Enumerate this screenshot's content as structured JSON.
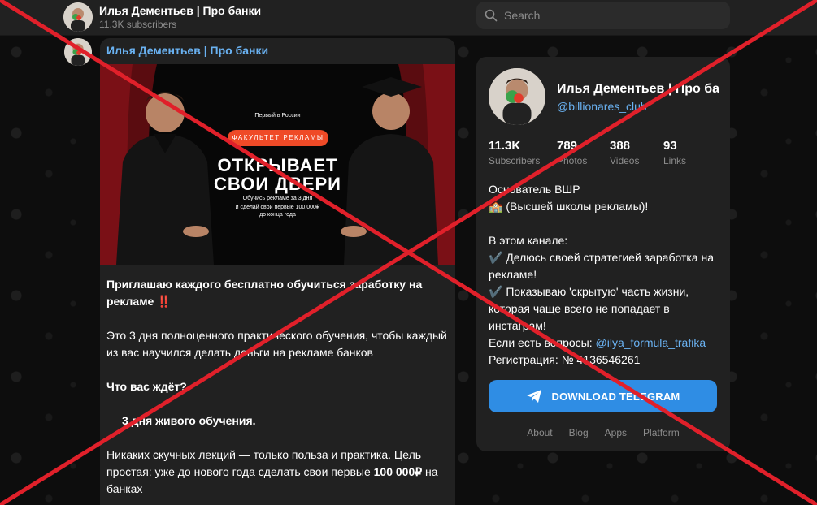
{
  "topbar": {
    "title": "Илья Дементьев | Про банки",
    "subscribers": "11.3K subscribers",
    "search_placeholder": "Search"
  },
  "post": {
    "channel_name": "Илья Дементьев | Про банки",
    "poster": {
      "kicker": "Первый в России",
      "pill": "ФАКУЛЬТЕТ РЕКЛАМЫ",
      "headline1": "ОТКРЫВАЕТ",
      "headline2": "СВОИ ДВЕРИ",
      "sub1": "Обучись рекламе за 3 дня",
      "sub2": "и сделай свои первые 100.000₽",
      "sub3": "до конца года"
    },
    "text": {
      "p1": "Приглашаю каждого бесплатно обучиться заработку на рекламе ‼️",
      "p2": "Это 3 дня полноценного практического обучения, чтобы каждый из вас научился делать деньги на рекламе банков",
      "p3": "Что вас ждёт?",
      "p4": "3 дня живого обучения.",
      "p5a": "Никаких скучных лекций — только польза и практика. Цель простая: уже до нового года сделать свои первые ",
      "p5b": "100 000₽",
      "p5c": " на банках"
    }
  },
  "card": {
    "name": "Илья Дементьев | Про банки",
    "handle": "@billionares_club",
    "stats": [
      {
        "value": "11.3K",
        "label": "Subscribers"
      },
      {
        "value": "789",
        "label": "Photos"
      },
      {
        "value": "388",
        "label": "Videos"
      },
      {
        "value": "93",
        "label": "Links"
      }
    ],
    "desc": {
      "l1": "Основатель ВШР",
      "l2": "🏫 (Высшей школы рекламы)!",
      "l3": "В этом канале:",
      "l4": "✔️ Делюсь своей стратегией заработка на рекламе!",
      "l5": "✔️ Показываю 'скрытую' часть жизни, которая чаще всего не попадает в инстаграм!",
      "l6_prefix": "Если есть вопросы: ",
      "l6_link": "@ilya_formula_trafika",
      "l7": "Регистрация: № 4136546261"
    },
    "download_label": "DOWNLOAD TELEGRAM",
    "footer": [
      "About",
      "Blog",
      "Apps",
      "Platform"
    ]
  },
  "colors": {
    "accent_link": "#6ab2f2",
    "button": "#2f8de4",
    "cross": "#e0202a",
    "panel": "#212121"
  }
}
